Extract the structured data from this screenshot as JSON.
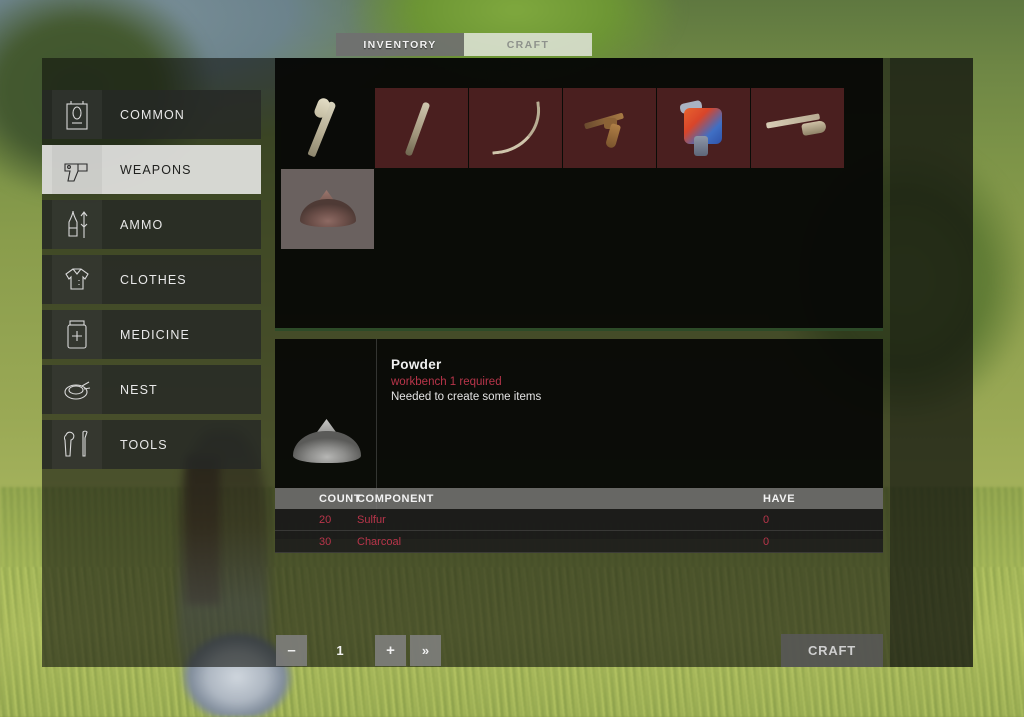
{
  "tabs": [
    {
      "id": "inventory",
      "label": "INVENTORY",
      "active": false
    },
    {
      "id": "craft",
      "label": "CRAFT",
      "active": true
    }
  ],
  "sidebar": {
    "items": [
      {
        "label": "COMMON",
        "icon": "bag-icon",
        "active": false
      },
      {
        "label": "WEAPONS",
        "icon": "pistol-icon",
        "active": true
      },
      {
        "label": "AMMO",
        "icon": "bullet-icon",
        "active": false
      },
      {
        "label": "CLOTHES",
        "icon": "shirt-icon",
        "active": false
      },
      {
        "label": "MEDICINE",
        "icon": "medkit-icon",
        "active": false
      },
      {
        "label": "NEST",
        "icon": "nest-icon",
        "active": false
      },
      {
        "label": "TOOLS",
        "icon": "tools-icon",
        "active": false
      }
    ]
  },
  "grid": {
    "slots": [
      {
        "name": "baseball-bat",
        "art": "bat",
        "state": "dark"
      },
      {
        "name": "wooden-club",
        "art": "club",
        "state": "locked"
      },
      {
        "name": "machete",
        "art": "machete",
        "state": "locked"
      },
      {
        "name": "revolver",
        "art": "revolver",
        "state": "locked"
      },
      {
        "name": "toy-gun",
        "art": "toy",
        "state": "locked"
      },
      {
        "name": "shotgun",
        "art": "shotgun",
        "state": "locked"
      },
      {
        "name": "powder",
        "art": "powder",
        "state": "sel"
      }
    ]
  },
  "detail": {
    "name": "Powder",
    "requirement": "workbench 1 required",
    "description": "Needed to create some items",
    "thumb_icon": "powder-pile-icon"
  },
  "components_table": {
    "headers": {
      "count": "COUNT",
      "component": "COMPONENT",
      "have": "HAVE"
    },
    "rows": [
      {
        "count": "20",
        "component": "Sulfur",
        "have": "0"
      },
      {
        "count": "30",
        "component": "Charcoal",
        "have": "0"
      }
    ]
  },
  "footer": {
    "decrease_label": "–",
    "quantity": "1",
    "increase_label": "+",
    "fast_forward_label": "»",
    "craft_label": "CRAFT"
  },
  "colors": {
    "danger_red": "#b8354a",
    "panel_bg": "#060705",
    "active_item_bg": "#e2e2e0",
    "locked_slot_bg": "#4a1f1f"
  }
}
